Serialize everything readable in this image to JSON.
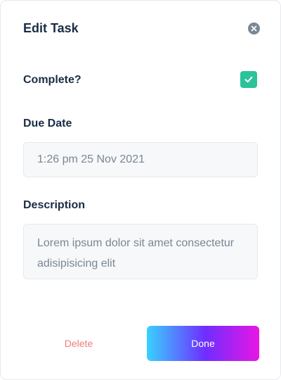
{
  "dialog": {
    "title": "Edit Task",
    "close_icon": "close-circle-icon"
  },
  "complete": {
    "label": "Complete?",
    "checked": true,
    "check_icon": "check-icon",
    "color": "#2cc39a"
  },
  "due_date": {
    "label": "Due Date",
    "value": "1:26 pm 25 Nov 2021"
  },
  "description": {
    "label": "Description",
    "value": "Lorem ipsum dolor sit amet consectetur adisipisicing elit"
  },
  "actions": {
    "delete_label": "Delete",
    "done_label": "Done",
    "delete_color": "#f07b7b",
    "done_gradient": [
      "#3ad1ff",
      "#6f2dff",
      "#e816e4"
    ]
  }
}
